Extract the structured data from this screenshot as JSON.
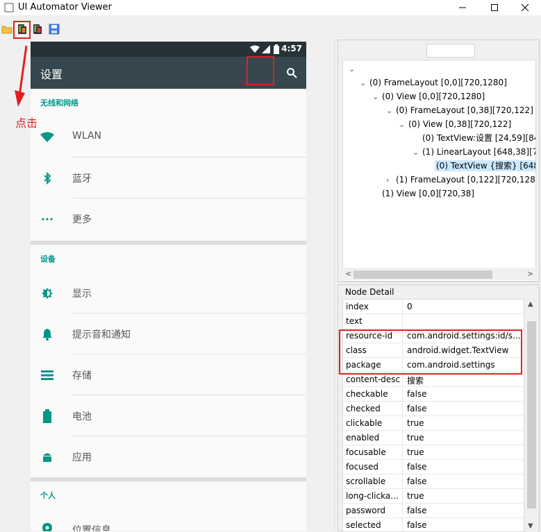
{
  "window": {
    "title": "UI Automator Viewer",
    "controls": [
      "minimize",
      "maximize",
      "close"
    ]
  },
  "toolbar": {
    "buttons": [
      {
        "name": "open-icon"
      },
      {
        "name": "device-screenshot-icon"
      },
      {
        "name": "device-screenshot-compressed-icon"
      },
      {
        "name": "save-icon"
      }
    ]
  },
  "annotation": {
    "click_text": "点击"
  },
  "phone": {
    "status_time": "4:57",
    "app_title": "设置",
    "sections": [
      {
        "header": "无线和网络",
        "items": [
          {
            "label": "WLAN",
            "icon": "wifi-icon"
          },
          {
            "label": "蓝牙",
            "icon": "bluetooth-icon"
          },
          {
            "label": "更多",
            "icon": "more-icon"
          }
        ]
      },
      {
        "header": "设备",
        "items": [
          {
            "label": "显示",
            "icon": "brightness-icon"
          },
          {
            "label": "提示音和通知",
            "icon": "bell-icon"
          },
          {
            "label": "存储",
            "icon": "storage-icon"
          },
          {
            "label": "电池",
            "icon": "battery-icon"
          },
          {
            "label": "应用",
            "icon": "android-icon"
          }
        ]
      },
      {
        "header": "个人",
        "items": [
          {
            "label": "位置信息",
            "icon": "location-icon"
          }
        ]
      }
    ]
  },
  "tree": {
    "rows": [
      {
        "text": "",
        "arrow": "v"
      },
      {
        "text": "(0) FrameLayout [0,0][720,1280]",
        "arrow": "v"
      },
      {
        "text": "(0) View [0,0][720,1280]",
        "arrow": "v"
      },
      {
        "text": "(0) FrameLayout [0,38][720,122]",
        "arrow": "v"
      },
      {
        "text": "(0) View [0,38][720,122]",
        "arrow": "v"
      },
      {
        "text": "(0) TextView:设置 [24,59][84",
        "arrow": ""
      },
      {
        "text": "(1) LinearLayout [648,38][72",
        "arrow": "v"
      },
      {
        "text": "(0) TextView {搜索} [648,4",
        "arrow": ""
      },
      {
        "text": "(1) FrameLayout [0,122][720,1280]",
        "arrow": ">"
      },
      {
        "text": "(1) View [0,0][720,38]",
        "arrow": ""
      }
    ]
  },
  "detail": {
    "title": "Node Detail",
    "rows": [
      {
        "key": "index",
        "value": "0"
      },
      {
        "key": "text",
        "value": ""
      },
      {
        "key": "resource-id",
        "value": "com.android.settings:id/s..."
      },
      {
        "key": "class",
        "value": "android.widget.TextView"
      },
      {
        "key": "package",
        "value": "com.android.settings"
      },
      {
        "key": "content-desc",
        "value": "搜索"
      },
      {
        "key": "checkable",
        "value": "false"
      },
      {
        "key": "checked",
        "value": "false"
      },
      {
        "key": "clickable",
        "value": "true"
      },
      {
        "key": "enabled",
        "value": "true"
      },
      {
        "key": "focusable",
        "value": "true"
      },
      {
        "key": "focused",
        "value": "false"
      },
      {
        "key": "scrollable",
        "value": "false"
      },
      {
        "key": "long-clicka...",
        "value": "true"
      },
      {
        "key": "password",
        "value": "false"
      },
      {
        "key": "selected",
        "value": "false"
      }
    ]
  },
  "colors": {
    "accent": "#009688",
    "appbar": "#37474f",
    "statusbar": "#263238",
    "highlight": "#e02020",
    "selection": "#cce8ff"
  }
}
